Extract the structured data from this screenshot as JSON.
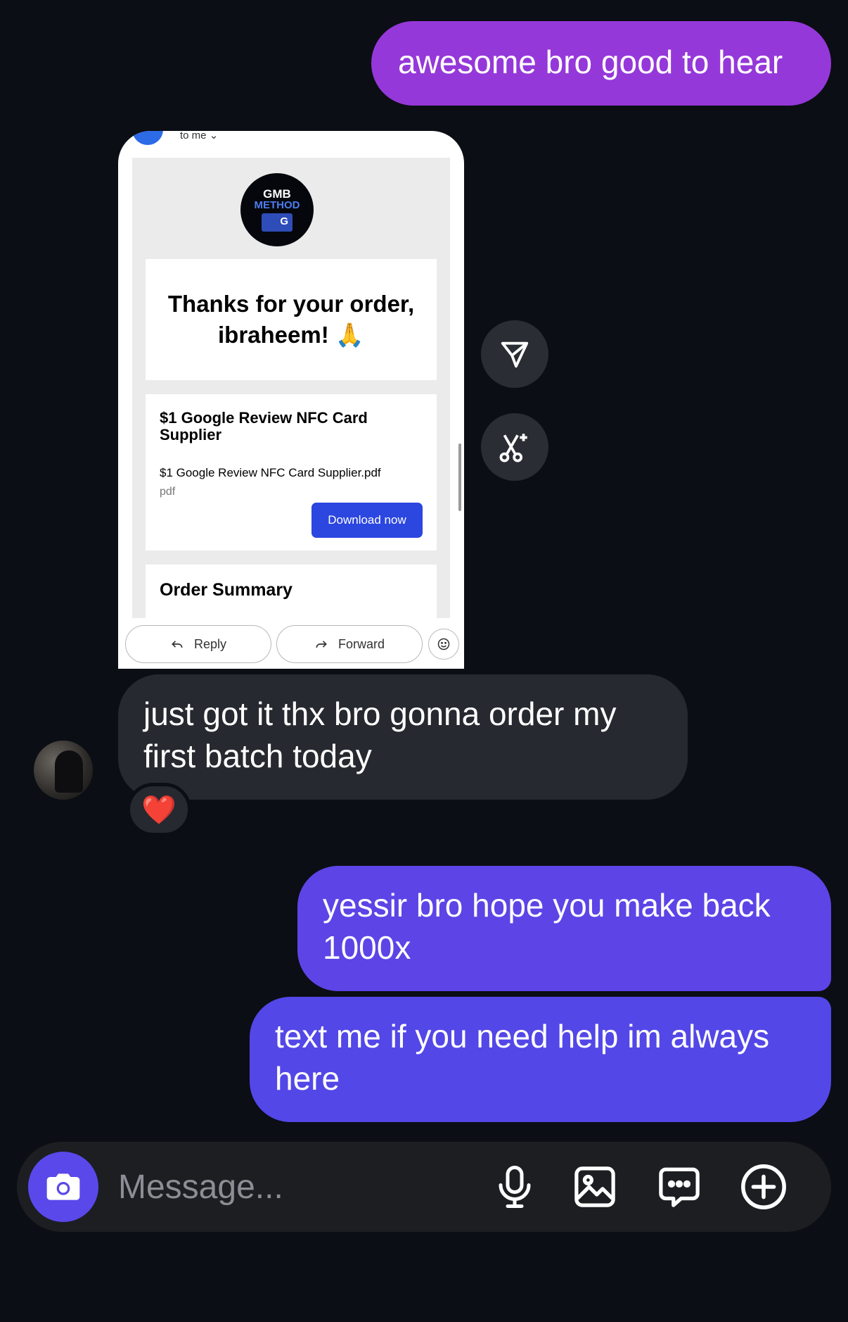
{
  "messages": {
    "sent_1": "awesome bro good to hear",
    "received_1": "just got it thx bro gonna order my first batch today",
    "sent_2": "yessir bro hope you make back 1000x",
    "sent_3": "text me if you need help im always here"
  },
  "email": {
    "to_label": "to me",
    "logo_line1": "GMB",
    "logo_line2": "METHOD",
    "thanks_title": "Thanks for your order, ibraheem! 🙏",
    "product_name": "$1 Google Review NFC Card Supplier",
    "file_name": "$1 Google Review NFC Card Supplier.pdf",
    "file_type": "pdf",
    "download_label": "Download now",
    "summary_title": "Order Summary",
    "reply_label": "Reply",
    "forward_label": "Forward"
  },
  "reaction": {
    "emoji": "❤️"
  },
  "composer": {
    "placeholder": "Message..."
  },
  "colors": {
    "background": "#0b0e14",
    "sent_bubble_top": "#9538d9",
    "sent_bubble": "#5c44e6",
    "received_bubble": "#26292f",
    "camera_button": "#5a48ea",
    "download_button": "#2c46e0"
  },
  "icons": [
    "send-icon",
    "remix-icon",
    "camera-icon",
    "mic-icon",
    "gallery-icon",
    "sticker-icon",
    "plus-circle-icon",
    "reply-icon",
    "forward-icon",
    "emoji-icon"
  ]
}
